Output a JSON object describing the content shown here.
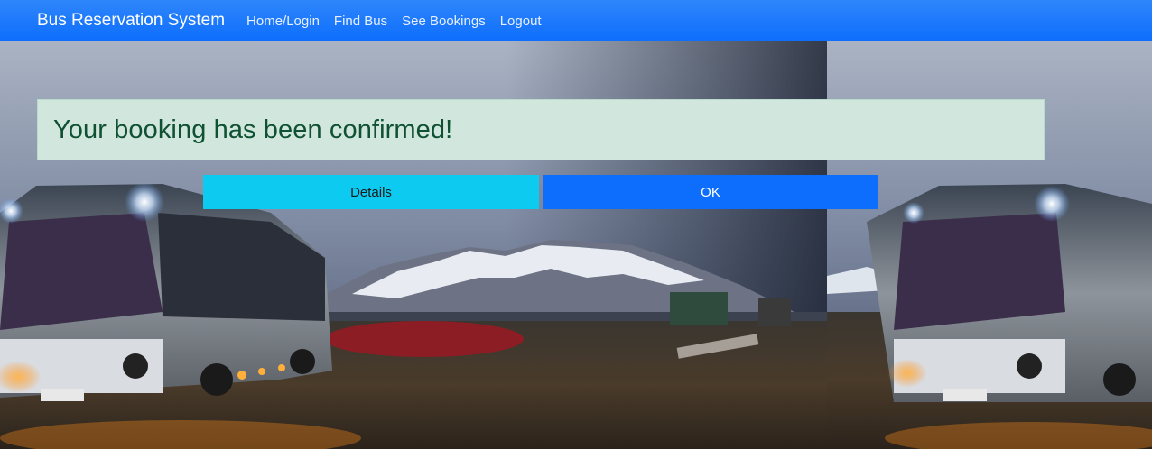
{
  "navbar": {
    "brand": "Bus Reservation System",
    "links": [
      "Home/Login",
      "Find Bus",
      "See Bookings",
      "Logout"
    ]
  },
  "alert": {
    "message": "Your booking has been confirmed!"
  },
  "actions": {
    "details_label": "Details",
    "ok_label": "OK"
  },
  "colors": {
    "navbar": "#0d6efd",
    "alert_bg": "#d1e7dd",
    "alert_text": "#0f5132",
    "details_button": "#0dcaf0",
    "ok_button": "#0d6efd"
  },
  "background_image": "bus-at-night-with-snowy-mountains"
}
